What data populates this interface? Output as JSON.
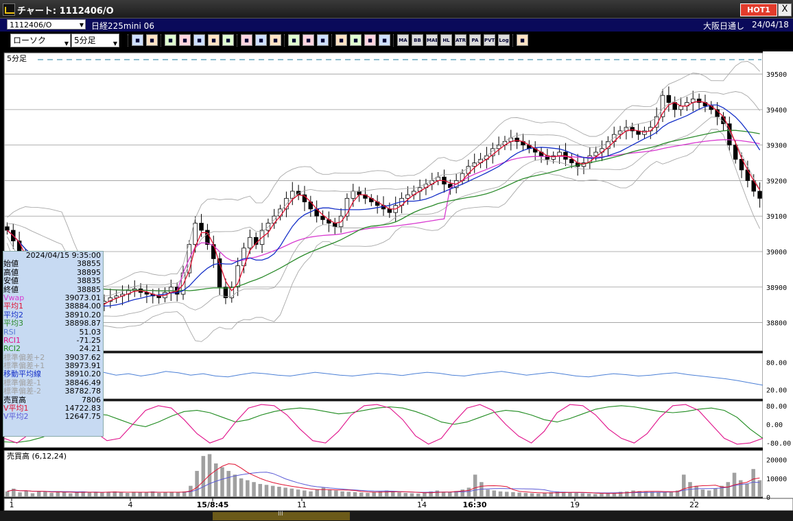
{
  "window": {
    "title": "チャート: 1112406/O",
    "hot_label": "HOT1",
    "close_label": "X"
  },
  "infobar": {
    "symbol": "1112406/O",
    "name": "日経225mini 06",
    "exchange": "大阪日通し",
    "date": "24/04/18"
  },
  "toolbar": {
    "chart_type": "ローソク",
    "interval": "5分足",
    "icons": [
      "zoom-icon",
      "cursor-icon",
      "candle-compare-icon",
      "search-chart-icon",
      "bar-chart-icon",
      "plus-minus-icon",
      "disabled-icon",
      "box-left-icon",
      "box-right-icon",
      "all-icon",
      "pen-icon",
      "arrow-select-icon",
      "eraser-icon",
      "gear-icon",
      "wrench-icon",
      "palette-icon",
      "grid-icon",
      "MA",
      "BB",
      "MAE",
      "HL",
      "ATR",
      "PA",
      "PVT",
      "Log",
      "exit-icon"
    ]
  },
  "colors": {
    "price_red": "#ff2020",
    "ma1": "#e01030",
    "ma2": "#1530c8",
    "ma3": "#2a8a2a",
    "vwap": "#d83ad0",
    "bands": "#a8a8a8",
    "rsi": "#4a7fd6",
    "rci1": "#e0108a",
    "rci2": "#1d8a1d",
    "volume": "#a0a0a0"
  },
  "chart_data": [
    {
      "type": "candlestick",
      "panel": "price",
      "interval_label": "5分足",
      "ylim": [
        38720,
        39560
      ],
      "y_ticks": [
        39500,
        39400,
        39300,
        39200,
        39100,
        39000,
        38900,
        38800
      ],
      "x_tick_labels": [
        "1",
        "4",
        "15/8:45",
        "11",
        "14",
        "16:30",
        "19",
        "22"
      ],
      "ohlc_anchor_close": [
        39060,
        39030,
        38990,
        38950,
        38930,
        38900,
        38880,
        38860,
        38850,
        38840,
        38830,
        38845,
        38850,
        38835,
        38840,
        38855,
        38860,
        38870,
        38875,
        38880,
        38890,
        38895,
        38885,
        38880,
        38875,
        38870,
        38885,
        38900,
        38880,
        38940,
        39020,
        39080,
        39060,
        39020,
        38980,
        38900,
        38870,
        38900,
        38960,
        39010,
        39040,
        39020,
        39060,
        39080,
        39100,
        39120,
        39150,
        39170,
        39160,
        39140,
        39120,
        39100,
        39090,
        39080,
        39070,
        39100,
        39150,
        39170,
        39160,
        39150,
        39140,
        39130,
        39120,
        39110,
        39130,
        39150,
        39160,
        39170,
        39180,
        39190,
        39200,
        39210,
        39190,
        39180,
        39200,
        39220,
        39240,
        39250,
        39260,
        39270,
        39290,
        39300,
        39310,
        39320,
        39310,
        39300,
        39290,
        39280,
        39270,
        39260,
        39270,
        39280,
        39260,
        39250,
        39240,
        39250,
        39270,
        39280,
        39290,
        39310,
        39330,
        39340,
        39350,
        39340,
        39330,
        39340,
        39350,
        39380,
        39440,
        39420,
        39400,
        39410,
        39420,
        39430,
        39420,
        39410,
        39400,
        39380,
        39360,
        39300,
        39260,
        39230,
        39200,
        39170,
        39150
      ],
      "series_lines": [
        {
          "name": "平均1",
          "color": "#e01030"
        },
        {
          "name": "平均2",
          "color": "#1530c8"
        },
        {
          "name": "平均3",
          "color": "#2a8a2a"
        },
        {
          "name": "Vwap",
          "color": "#d83ad0"
        }
      ]
    },
    {
      "type": "line",
      "panel": "rsi",
      "ylim": [
        0,
        100
      ],
      "y_ticks": [
        80,
        20
      ],
      "y_tick_labels": [
        "80.00",
        "20.00"
      ],
      "series": [
        {
          "name": "RSI",
          "values": [
            45,
            50,
            48,
            52,
            55,
            47,
            50,
            53,
            58,
            52,
            55,
            50,
            54,
            60,
            57,
            52,
            55,
            50,
            48,
            53,
            57,
            55,
            52,
            50,
            54,
            58,
            55,
            52,
            50,
            53,
            56,
            54,
            51,
            55,
            58,
            56,
            52,
            50,
            54,
            57,
            60,
            56,
            52,
            55,
            58,
            54,
            50,
            48,
            52,
            55,
            53,
            50,
            52,
            55,
            57,
            53,
            50,
            47,
            44,
            40,
            35,
            30
          ]
        }
      ]
    },
    {
      "type": "line",
      "panel": "rci",
      "ylim": [
        -100,
        100
      ],
      "y_ticks": [
        80,
        0,
        -80
      ],
      "y_tick_labels": [
        "80.00",
        "0.00",
        "-80.00"
      ],
      "series": [
        {
          "name": "RCI1",
          "values": [
            -60,
            -80,
            -40,
            20,
            70,
            80,
            40,
            -30,
            -70,
            -60,
            0,
            60,
            80,
            70,
            20,
            -40,
            -80,
            -60,
            10,
            70,
            85,
            80,
            40,
            -20,
            -70,
            -80,
            -30,
            40,
            80,
            85,
            70,
            20,
            -50,
            -85,
            -60,
            10,
            70,
            85,
            60,
            0,
            -50,
            -80,
            -30,
            50,
            85,
            80,
            40,
            -20,
            -60,
            -80,
            -40,
            30,
            80,
            85,
            60,
            0,
            -60,
            -85,
            -80,
            -60
          ]
        },
        {
          "name": "RCI2",
          "values": [
            -75,
            -78,
            -70,
            -55,
            -30,
            0,
            30,
            45,
            40,
            20,
            0,
            -10,
            10,
            35,
            55,
            60,
            50,
            30,
            10,
            20,
            40,
            55,
            65,
            70,
            65,
            55,
            45,
            50,
            60,
            70,
            75,
            70,
            55,
            35,
            10,
            0,
            10,
            30,
            50,
            60,
            55,
            40,
            20,
            10,
            25,
            45,
            65,
            75,
            80,
            75,
            65,
            55,
            50,
            55,
            65,
            70,
            60,
            30,
            -20,
            -60
          ]
        }
      ]
    },
    {
      "type": "bar",
      "panel": "volume",
      "title": "売買高 (6,12,24)",
      "ylim": [
        0,
        25000
      ],
      "y_ticks": [
        20000,
        10000,
        0
      ],
      "y_tick_labels": [
        "20000",
        "10000",
        "0"
      ],
      "values": [
        3000,
        4500,
        2500,
        3500,
        2000,
        3000,
        2800,
        2200,
        3000,
        2600,
        2000,
        2400,
        3000,
        2500,
        2800,
        2300,
        2600,
        3000,
        2500,
        2200,
        2800,
        2400,
        2600,
        3000,
        2200,
        2400,
        2800,
        2500,
        3000,
        6000,
        14000,
        22000,
        23000,
        18000,
        16000,
        14000,
        12000,
        10000,
        9000,
        8000,
        7000,
        6500,
        6000,
        5500,
        5000,
        4500,
        4000,
        3500,
        3000,
        4000,
        5000,
        4000,
        3500,
        3000,
        2800,
        2600,
        2400,
        2200,
        2600,
        3000,
        3500,
        3000,
        2500,
        2200,
        2000,
        1800,
        2500,
        3000,
        3500,
        2800,
        2600,
        3200,
        4000,
        5000,
        12000,
        8000,
        4000,
        3500,
        3000,
        2800,
        2600,
        2400,
        2200,
        2000,
        1800,
        2200,
        2600,
        3000,
        2800,
        2500,
        2200,
        2000,
        1800,
        1600,
        1800,
        2000,
        2400,
        2800,
        3000,
        3500,
        3200,
        3000,
        2800,
        2600,
        2400,
        3000,
        3500,
        12000,
        8000,
        6000,
        4000,
        3500,
        4500,
        6000,
        8000,
        13000,
        9000,
        7000,
        15000,
        9000
      ]
    }
  ],
  "info_panel": {
    "timestamp": "2024/04/15 9:35:00",
    "rows": [
      {
        "label": "始値",
        "value": "38855",
        "color": "#000000"
      },
      {
        "label": "高値",
        "value": "38895",
        "color": "#000000"
      },
      {
        "label": "安値",
        "value": "38835",
        "color": "#000000"
      },
      {
        "label": "終値",
        "value": "38885",
        "color": "#000000"
      },
      {
        "label": "Vwap",
        "value": "39073.01",
        "color": "#d83ad0"
      },
      {
        "label": "平均1",
        "value": "38884.00",
        "color": "#e01030"
      },
      {
        "label": "平均2",
        "value": "38910.20",
        "color": "#1530c8"
      },
      {
        "label": "平均3",
        "value": "38898.87",
        "color": "#2a8a2a"
      },
      {
        "label": "RSI",
        "value": "51.03",
        "color": "#5a7bd6"
      },
      {
        "label": "RCI1",
        "value": "-71.25",
        "color": "#e0108a"
      },
      {
        "label": "RCI2",
        "value": "24.21",
        "color": "#1d8a1d"
      },
      {
        "label": "標準偏差+2",
        "value": "39037.62",
        "color": "#a0a0a0"
      },
      {
        "label": "標準偏差+1",
        "value": "38973.91",
        "color": "#a0a0a0"
      },
      {
        "label": "移動平均線",
        "value": "38910.20",
        "color": "#1530c8"
      },
      {
        "label": "標準偏差-1",
        "value": "38846.49",
        "color": "#a0a0a0"
      },
      {
        "label": "標準偏差-2",
        "value": "38782.78",
        "color": "#a0a0a0"
      },
      {
        "label": "売買高",
        "value": "7806",
        "color": "#000000"
      },
      {
        "label": "V平均1",
        "value": "14722.83",
        "color": "#e01030"
      },
      {
        "label": "V平均2",
        "value": "12647.75",
        "color": "#5a5ad6"
      }
    ]
  }
}
